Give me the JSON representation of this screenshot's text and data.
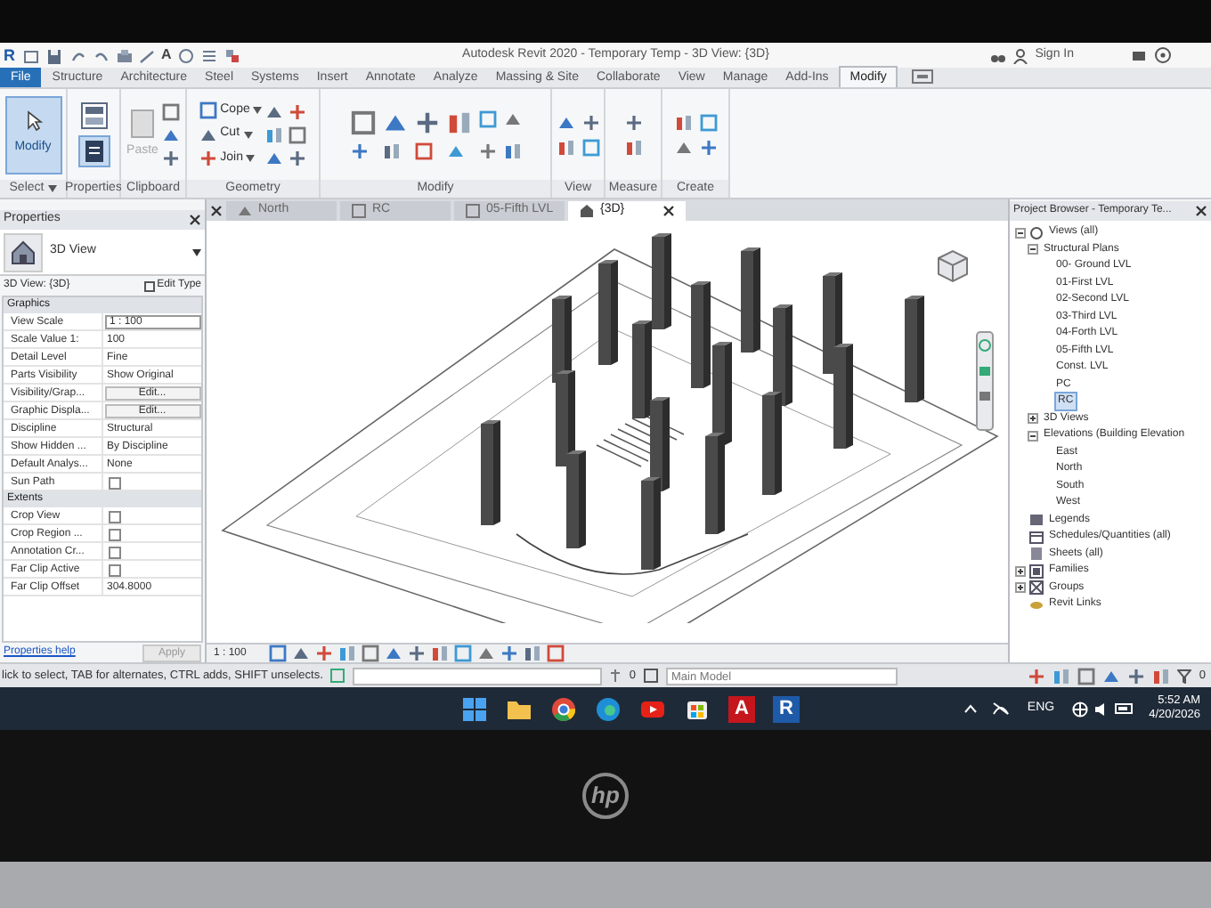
{
  "title_bar": {
    "app_logo": "R",
    "text_tool": "A",
    "title": "Autodesk Revit 2020 - Temporary Temp - 3D View: {3D}",
    "sign_in": "Sign In"
  },
  "ribbon": {
    "tabs": [
      {
        "label": "File",
        "kind": "file",
        "selected": false
      },
      {
        "label": "Structure",
        "kind": "tab",
        "selected": false
      },
      {
        "label": "Architecture",
        "kind": "tab",
        "selected": false
      },
      {
        "label": "Steel",
        "kind": "tab",
        "selected": false
      },
      {
        "label": "Systems",
        "kind": "tab",
        "selected": false
      },
      {
        "label": "Insert",
        "kind": "tab",
        "selected": false
      },
      {
        "label": "Annotate",
        "kind": "tab",
        "selected": false
      },
      {
        "label": "Analyze",
        "kind": "tab",
        "selected": false
      },
      {
        "label": "Massing & Site",
        "kind": "tab",
        "selected": false
      },
      {
        "label": "Collaborate",
        "kind": "tab",
        "selected": false
      },
      {
        "label": "View",
        "kind": "tab",
        "selected": false
      },
      {
        "label": "Manage",
        "kind": "tab",
        "selected": false
      },
      {
        "label": "Add-Ins",
        "kind": "tab",
        "selected": false
      },
      {
        "label": "Modify",
        "kind": "tab",
        "selected": true
      }
    ],
    "modify_button": {
      "label": "Modify",
      "selected": true
    },
    "paste_button": {
      "label": "Paste",
      "disabled": true
    },
    "geometry_buttons": [
      "Cope",
      "Cut",
      "Join"
    ],
    "panels": [
      {
        "label": "Select",
        "dropdown": true
      },
      {
        "label": "Properties",
        "dropdown": false
      },
      {
        "label": "Clipboard",
        "dropdown": false
      },
      {
        "label": "Geometry",
        "dropdown": false
      },
      {
        "label": "Modify",
        "dropdown": false
      },
      {
        "label": "View",
        "dropdown": false
      },
      {
        "label": "Measure",
        "dropdown": false
      },
      {
        "label": "Create",
        "dropdown": false
      }
    ]
  },
  "properties": {
    "title": "Properties",
    "type_name": "3D View",
    "view_selector": "3D View: {3D}",
    "edit_type": "Edit Type",
    "groups": [
      {
        "label": "Graphics",
        "rows": [
          {
            "label": "View Scale",
            "kind": "input",
            "value": "1 : 100"
          },
          {
            "label": "Scale Value 1:",
            "kind": "text",
            "value": "100"
          },
          {
            "label": "Detail Level",
            "kind": "text",
            "value": "Fine"
          },
          {
            "label": "Parts Visibility",
            "kind": "text",
            "value": "Show Original"
          },
          {
            "label": "Visibility/Grap...",
            "kind": "button",
            "value": "Edit..."
          },
          {
            "label": "Graphic Displa...",
            "kind": "button",
            "value": "Edit..."
          },
          {
            "label": "Discipline",
            "kind": "text",
            "value": "Structural"
          },
          {
            "label": "Show Hidden ...",
            "kind": "text",
            "value": "By Discipline"
          },
          {
            "label": "Default Analys...",
            "kind": "text",
            "value": "None"
          },
          {
            "label": "Sun Path",
            "kind": "checkbox",
            "checked": false
          }
        ]
      },
      {
        "label": "Extents",
        "rows": [
          {
            "label": "Crop View",
            "kind": "checkbox",
            "checked": false
          },
          {
            "label": "Crop Region ...",
            "kind": "checkbox",
            "checked": false
          },
          {
            "label": "Annotation Cr...",
            "kind": "checkbox",
            "checked": false
          },
          {
            "label": "Far Clip Active",
            "kind": "checkbox",
            "checked": false
          },
          {
            "label": "Far Clip Offset",
            "kind": "text",
            "value": "304.8000"
          }
        ]
      }
    ],
    "help_link": "Properties help",
    "apply": "Apply"
  },
  "view_tabs": [
    {
      "label": "North",
      "kind": "elevation",
      "selected": false
    },
    {
      "label": "RC",
      "kind": "plan",
      "selected": false
    },
    {
      "label": "05-Fifth LVL",
      "kind": "plan",
      "selected": false
    },
    {
      "label": "{3D}",
      "kind": "threed",
      "selected": true
    }
  ],
  "view_control": {
    "scale": "1 : 100"
  },
  "browser": {
    "title": "Project Browser - Temporary Te...",
    "tree": [
      {
        "label": "Views (all)",
        "kind": "views",
        "expanded": true,
        "selected": false,
        "children": [
          {
            "label": "Structural Plans",
            "expanded": true,
            "selected": false,
            "children": [
              {
                "label": "00- Ground LVL",
                "selected": false
              },
              {
                "label": "01-First LVL",
                "selected": false
              },
              {
                "label": "02-Second LVL",
                "selected": false
              },
              {
                "label": "03-Third LVL",
                "selected": false
              },
              {
                "label": "04-Forth LVL",
                "selected": false
              },
              {
                "label": "05-Fifth LVL",
                "selected": false
              },
              {
                "label": "Const. LVL",
                "selected": false
              },
              {
                "label": "PC",
                "selected": false
              },
              {
                "label": "RC",
                "selected": true
              }
            ]
          },
          {
            "label": "3D Views",
            "expanded": false,
            "selected": false
          },
          {
            "label": "Elevations (Building Elevation",
            "expanded": true,
            "selected": false,
            "children": [
              {
                "label": "East",
                "selected": false
              },
              {
                "label": "North",
                "selected": false
              },
              {
                "label": "South",
                "selected": false
              },
              {
                "label": "West",
                "selected": false
              }
            ]
          }
        ]
      },
      {
        "label": "Legends",
        "kind": "legends",
        "selected": false
      },
      {
        "label": "Schedules/Quantities (all)",
        "kind": "schedules",
        "selected": false
      },
      {
        "label": "Sheets (all)",
        "kind": "sheets",
        "selected": false
      },
      {
        "label": "Families",
        "kind": "families",
        "expanded": false,
        "selected": false
      },
      {
        "label": "Groups",
        "kind": "groups",
        "expanded": false,
        "selected": false
      },
      {
        "label": "Revit Links",
        "kind": "links",
        "selected": false
      }
    ]
  },
  "status_bar": {
    "text": "lick to select, TAB for alternates, CTRL adds, SHIFT unselects.",
    "selection_count": "0",
    "model": "Main Model",
    "filter_count": "0"
  },
  "taskbar": {
    "apps": [
      {
        "kind": "start"
      },
      {
        "kind": "folder"
      },
      {
        "kind": "chrome"
      },
      {
        "kind": "edge"
      },
      {
        "kind": "video"
      },
      {
        "kind": "store"
      },
      {
        "kind": "letter",
        "letter": "A",
        "color": "#c4161c"
      },
      {
        "kind": "letter",
        "letter": "R",
        "color": "#1e5aa8"
      }
    ],
    "language": "ENG",
    "time": "5:52 AM",
    "date": "4/20/2026"
  },
  "laptop": {
    "logo": "hp"
  }
}
